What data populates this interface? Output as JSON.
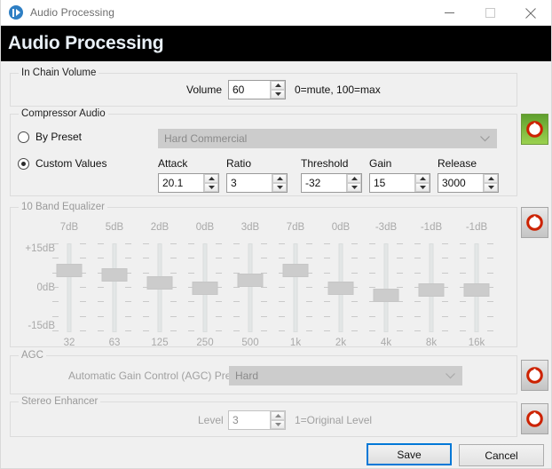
{
  "window": {
    "title": "Audio Processing",
    "app_icon": "audio-play-icon",
    "minimize_label": "Minimize",
    "maximize_label": "Maximize",
    "close_label": "Close"
  },
  "header": {
    "title": "Audio Processing"
  },
  "in_chain_volume": {
    "group_title": "In Chain Volume",
    "volume_label": "Volume",
    "volume_value": "60",
    "hint": "0=mute, 100=max"
  },
  "compressor": {
    "group_title": "Compressor Audio",
    "by_preset_label": "By Preset",
    "custom_values_label": "Custom Values",
    "selected_mode": "custom",
    "preset_value": "Hard Commercial",
    "power_state": "on",
    "power_icon": "power-icon",
    "fields": [
      {
        "label": "Attack",
        "value": "20.1"
      },
      {
        "label": "Ratio",
        "value": "3"
      },
      {
        "label": "Threshold",
        "value": "-32"
      },
      {
        "label": "Gain",
        "value": "15"
      },
      {
        "label": "Release",
        "value": "3000"
      }
    ]
  },
  "equalizer": {
    "group_title": "10 Band Equalizer",
    "power_state": "off",
    "power_icon": "power-icon",
    "y_labels": [
      "+15dB",
      "0dB",
      "-15dB"
    ],
    "bands": [
      {
        "freq": "32",
        "db_label": "7dB",
        "db": 7
      },
      {
        "freq": "63",
        "db_label": "5dB",
        "db": 5
      },
      {
        "freq": "125",
        "db_label": "2dB",
        "db": 2
      },
      {
        "freq": "250",
        "db_label": "0dB",
        "db": 0
      },
      {
        "freq": "500",
        "db_label": "3dB",
        "db": 3
      },
      {
        "freq": "1k",
        "db_label": "7dB",
        "db": 7
      },
      {
        "freq": "2k",
        "db_label": "0dB",
        "db": 0
      },
      {
        "freq": "4k",
        "db_label": "-3dB",
        "db": -3
      },
      {
        "freq": "8k",
        "db_label": "-1dB",
        "db": -1
      },
      {
        "freq": "16k",
        "db_label": "-1dB",
        "db": -1
      }
    ]
  },
  "agc": {
    "group_title": "AGC",
    "preset_label": "Automatic Gain Control (AGC) Preset",
    "preset_value": "Hard",
    "power_state": "off",
    "power_icon": "power-icon"
  },
  "stereo_enhancer": {
    "group_title": "Stereo Enhancer",
    "level_label": "Level",
    "level_value": "3",
    "hint": "1=Original Level",
    "power_state": "off",
    "power_icon": "power-icon"
  },
  "footer": {
    "save_label": "Save",
    "cancel_label": "Cancel"
  },
  "colors": {
    "header_bg": "#000000",
    "header_text": "#e9f0f7",
    "accent_focus": "#0078d7",
    "power_on": "#9bd14e",
    "power_off": "#c4c4c4",
    "power_glyph": "#cc2200",
    "app_icon": "#2e7fc4"
  }
}
